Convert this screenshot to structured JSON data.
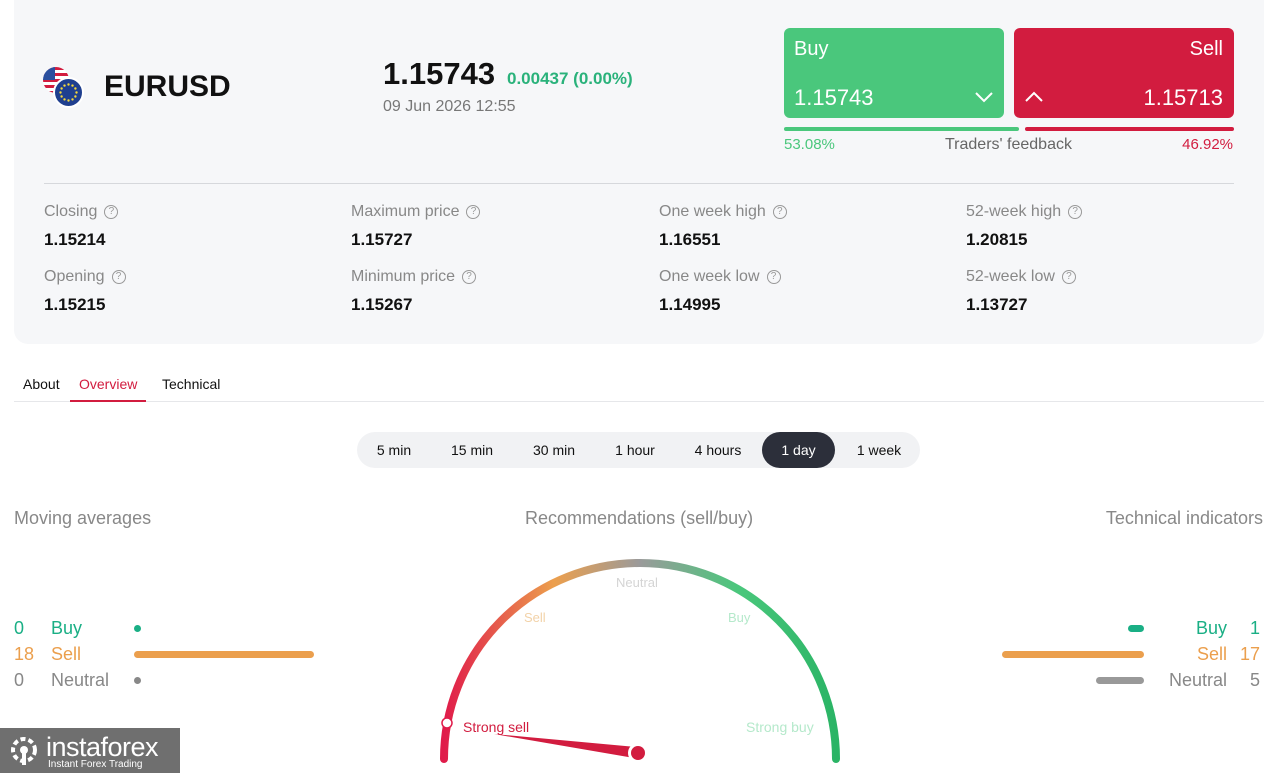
{
  "instrument": {
    "symbol": "EURUSD",
    "price": "1.15743",
    "change": "0.00437 (0.00%)",
    "datetime": "09 Jun 2026 12:55"
  },
  "trade": {
    "buy_label": "Buy",
    "buy_price": "1.15743",
    "sell_label": "Sell",
    "sell_price": "1.15713",
    "buy_color": "#4ac77c",
    "sell_color": "#d21c3f"
  },
  "feedback": {
    "label": "Traders' feedback",
    "buy_pct": "53.08%",
    "sell_pct": "46.92%",
    "buy_fraction": 0.5308
  },
  "stats": [
    {
      "label": "Closing",
      "value": "1.15214"
    },
    {
      "label": "Opening",
      "value": "1.15215"
    },
    {
      "label": "Maximum price",
      "value": "1.15727"
    },
    {
      "label": "Minimum price",
      "value": "1.15267"
    },
    {
      "label": "One week high",
      "value": "1.16551"
    },
    {
      "label": "One week low",
      "value": "1.14995"
    },
    {
      "label": "52-week high",
      "value": "1.20815"
    },
    {
      "label": "52-week low",
      "value": "1.13727"
    }
  ],
  "help_glyph": "?",
  "tabs": [
    "About",
    "Overview",
    "Technical"
  ],
  "active_tab": "Overview",
  "periods": [
    "5 min",
    "15 min",
    "30 min",
    "1 hour",
    "4 hours",
    "1 day",
    "1 week"
  ],
  "active_period": "1 day",
  "moving_averages": {
    "title": "Moving averages",
    "rows": [
      {
        "count": "0",
        "label": "Buy",
        "color": "#1aaf85"
      },
      {
        "count": "18",
        "label": "Sell",
        "color": "#eb9f4d"
      },
      {
        "count": "0",
        "label": "Neutral",
        "color": "#888888"
      }
    ]
  },
  "recommendation": {
    "title": "Recommendations (sell/buy)",
    "labels": {
      "strong_sell": "Strong sell",
      "sell": "Sell",
      "neutral": "Neutral",
      "buy": "Buy",
      "strong_buy": "Strong buy"
    },
    "value": "Strong sell"
  },
  "technical_indicators": {
    "title": "Technical indicators",
    "rows": [
      {
        "label": "Buy",
        "count": "1",
        "color": "#1aaf85"
      },
      {
        "label": "Sell",
        "count": "17",
        "color": "#eb9f4d"
      },
      {
        "label": "Neutral",
        "count": "5",
        "color": "#888888"
      }
    ]
  },
  "logo": {
    "name": "instaforex",
    "tagline": "Instant Forex Trading"
  }
}
